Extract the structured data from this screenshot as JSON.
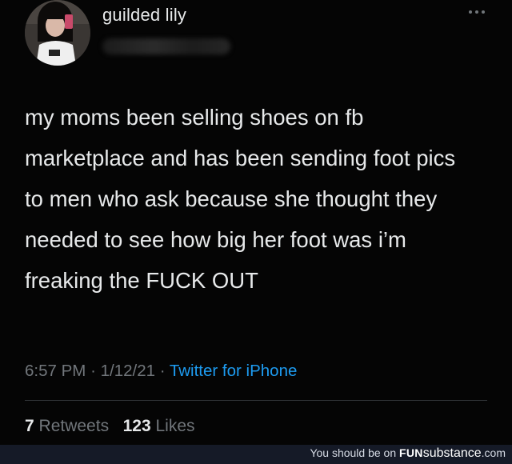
{
  "tweet": {
    "display_name": "guilded lily",
    "text": "my moms been selling shoes on fb marketplace and has been sending foot pics to men who ask because she thought they needed to see how big her foot was i’m freaking the FUCK OUT",
    "time": "6:57 PM",
    "date": "1/12/21",
    "separator": "·",
    "source": "Twitter for iPhone",
    "retweets_count": "7",
    "retweets_label": "Retweets",
    "likes_count": "123",
    "likes_label": "Likes"
  },
  "icons": {
    "more": "more-dots-icon",
    "avatar": "avatar"
  },
  "colors": {
    "background": "#000000",
    "text": "#e7e9ea",
    "muted": "#71767b",
    "link": "#1d9bf0",
    "footer_bg": "#151a27"
  },
  "footer": {
    "tagline": "You should be on",
    "brand_bold": "FUN",
    "brand_rest": "substance",
    "brand_tld": ".com"
  }
}
